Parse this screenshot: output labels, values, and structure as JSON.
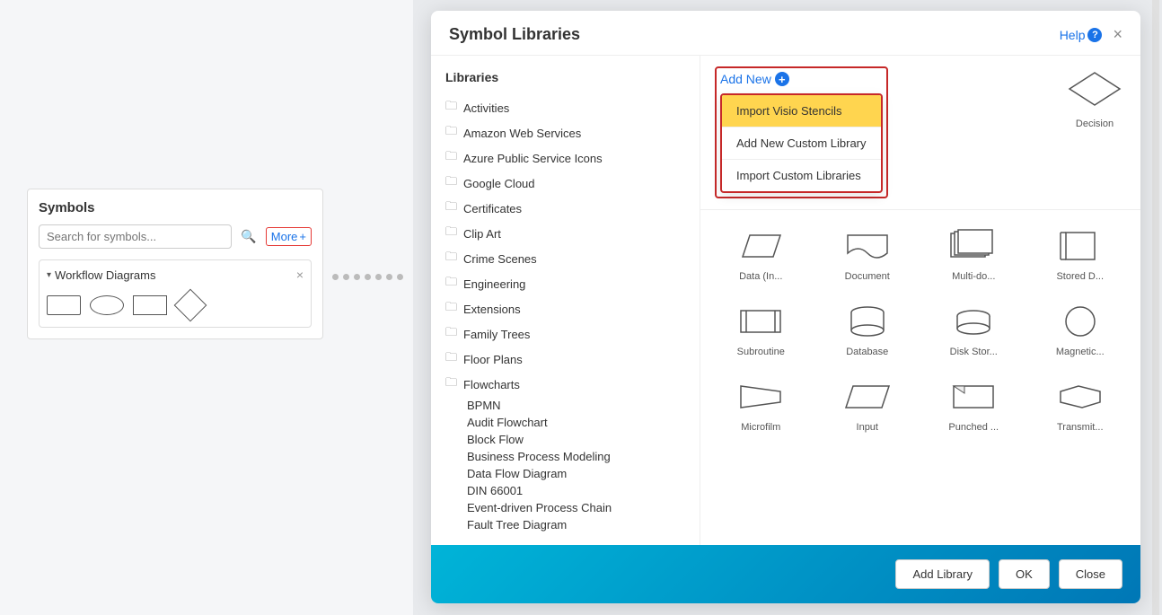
{
  "sidebar": {
    "title": "Symbols",
    "search_placeholder": "Search for symbols...",
    "more_label": "More",
    "more_icon": "+",
    "workflow_label": "Workflow Diagrams"
  },
  "dialog": {
    "title": "Symbol Libraries",
    "help_label": "Help",
    "libraries_title": "Libraries",
    "add_new_label": "Add New",
    "add_new_icon": "+",
    "library_items": [
      "Activities",
      "Amazon Web Services",
      "Azure Public Service Icons",
      "Google Cloud",
      "Certificates",
      "Clip Art",
      "Crime Scenes",
      "Engineering",
      "Extensions",
      "Family Trees",
      "Floor Plans",
      "Flowcharts"
    ],
    "flowchart_subitems": [
      "BPMN",
      "Audit Flowchart",
      "Block Flow",
      "Business Process Modeling",
      "Data Flow Diagram",
      "DIN 66001",
      "Event-driven Process Chain",
      "Fault Tree Diagram"
    ],
    "dropdown": {
      "item1": "Import Visio Stencils",
      "item2": "Add New Custom Library",
      "item3": "Import Custom Libraries"
    },
    "shapes": [
      {
        "label": "Data (In...",
        "type": "parallelogram"
      },
      {
        "label": "Document",
        "type": "document"
      },
      {
        "label": "Multi-do...",
        "type": "multidoc"
      },
      {
        "label": "Stored D...",
        "type": "stored"
      },
      {
        "label": "Subroutine",
        "type": "subroutine"
      },
      {
        "label": "Database",
        "type": "database"
      },
      {
        "label": "Disk Stor...",
        "type": "disk"
      },
      {
        "label": "Magnetic...",
        "type": "circle"
      },
      {
        "label": "Microfilm",
        "type": "microfilm"
      },
      {
        "label": "Input",
        "type": "input"
      },
      {
        "label": "Punched ...",
        "type": "punched"
      },
      {
        "label": "Transmit...",
        "type": "transmit"
      }
    ],
    "decision_label": "Decision",
    "footer": {
      "add_library": "Add Library",
      "ok": "OK",
      "close": "Close"
    }
  }
}
